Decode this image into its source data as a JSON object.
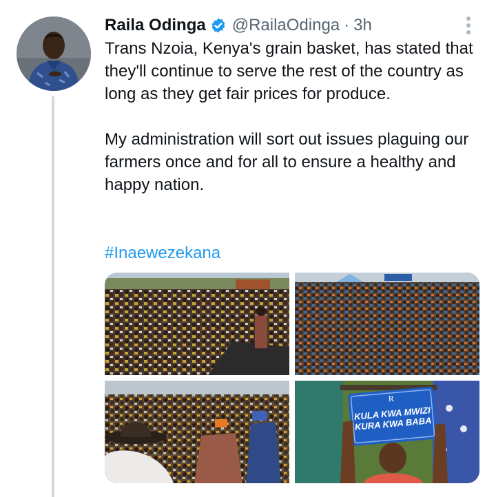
{
  "tweet": {
    "author_name": "Raila Odinga",
    "handle": "@RailaOdinga",
    "separator": "·",
    "time": "3h",
    "paragraphs": [
      "Trans Nzoia, Kenya's grain basket, has stated that they'll continue to serve the rest of the country as long as they get fair prices for produce.",
      "My administration will sort out issues plaguing our farmers once and for all to ensure a healthy and happy nation."
    ],
    "hashtag": "#Inaewezekana",
    "photos": [
      "crowd-rally-photo",
      "crowd-aerial-photo",
      "crowd-hats-photo",
      "supporter-sign-photo"
    ],
    "sign_text": [
      "KULA KWA MWIZI",
      "KURA KWA BABA"
    ]
  },
  "colors": {
    "accent": "#1d9bf0",
    "text": "#0f1419",
    "muted": "#536471",
    "thread_line": "#cfd9de"
  },
  "icons": {
    "verified": "verified-badge-icon",
    "more": "more-options-icon"
  }
}
